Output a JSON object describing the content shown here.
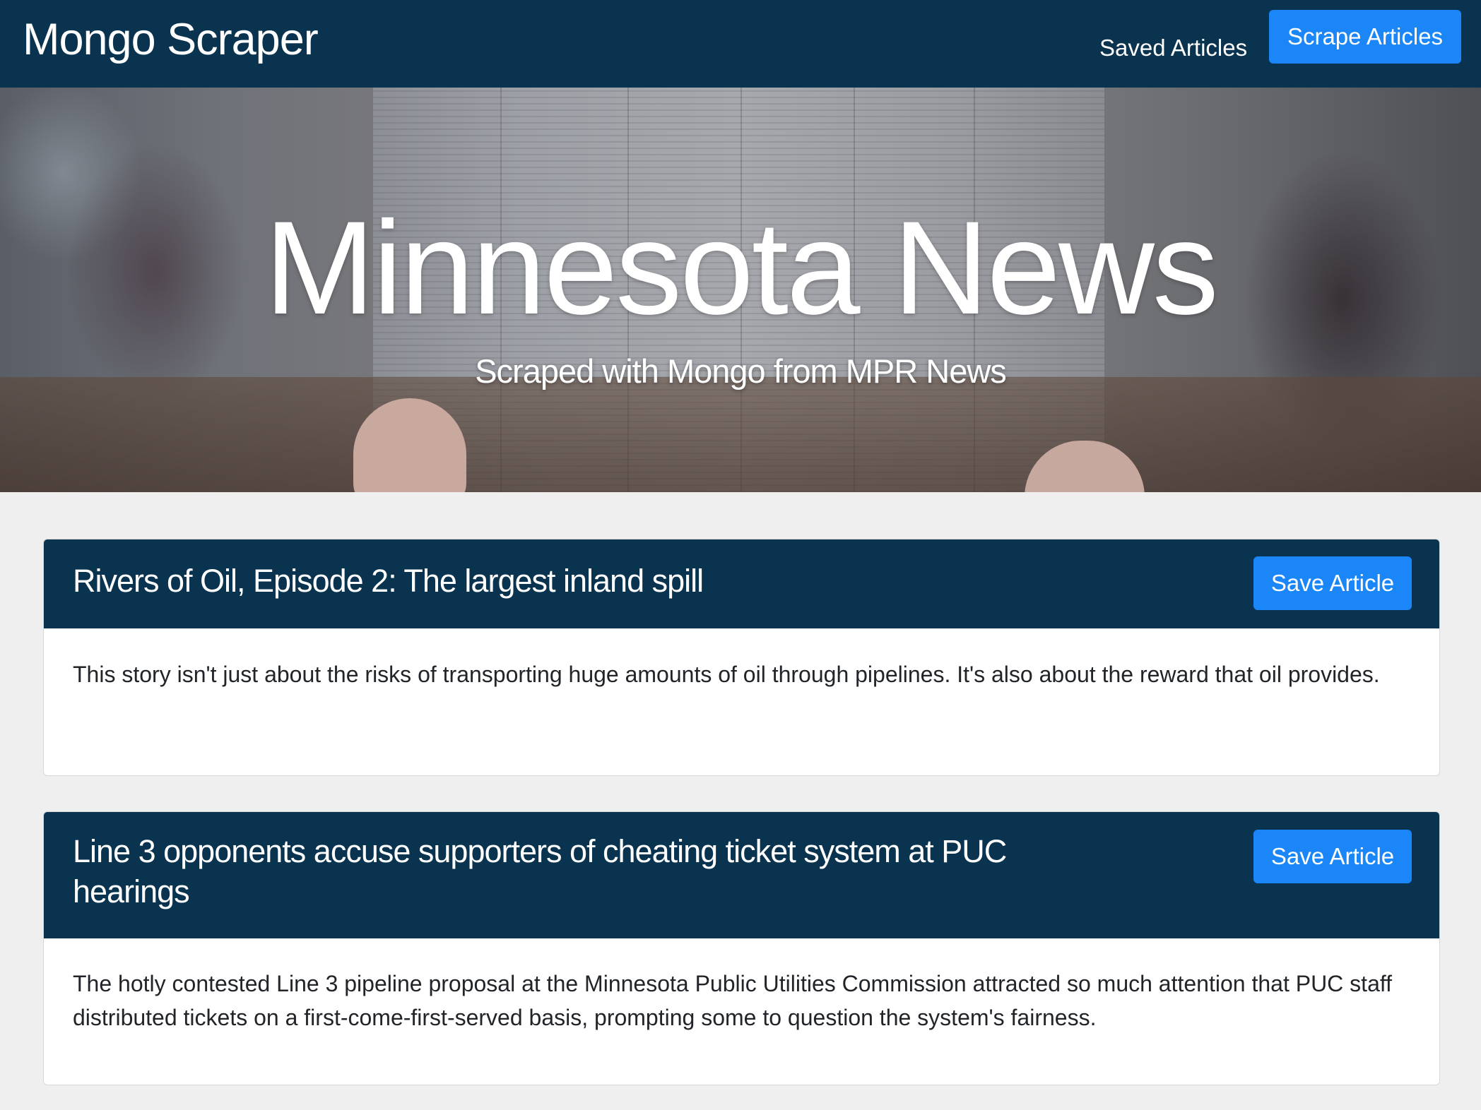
{
  "navbar": {
    "brand": "Mongo Scraper",
    "saved_link": "Saved Articles",
    "scrape_button": "Scrape Articles"
  },
  "hero": {
    "title": "Minnesota News",
    "subtitle": "Scraped with Mongo from MPR News"
  },
  "articles": [
    {
      "title": "Rivers of Oil, Episode 2: The largest inland spill",
      "summary": "This story isn't just about the risks of transporting huge amounts of oil through pipelines. It's also about the reward that oil provides.",
      "save_label": "Save Article"
    },
    {
      "title": "Line 3 opponents accuse supporters of cheating ticket system at PUC hearings",
      "summary": "The hotly contested Line 3 pipeline proposal at the Minnesota Public Utilities Commission attracted so much attention that PUC staff distributed tickets on a first-come-first-served basis, prompting some to question the system's fairness.",
      "save_label": "Save Article"
    }
  ],
  "colors": {
    "navbar_bg": "#0a3350",
    "button_bg": "#1a86f7",
    "page_bg": "#efefef"
  }
}
